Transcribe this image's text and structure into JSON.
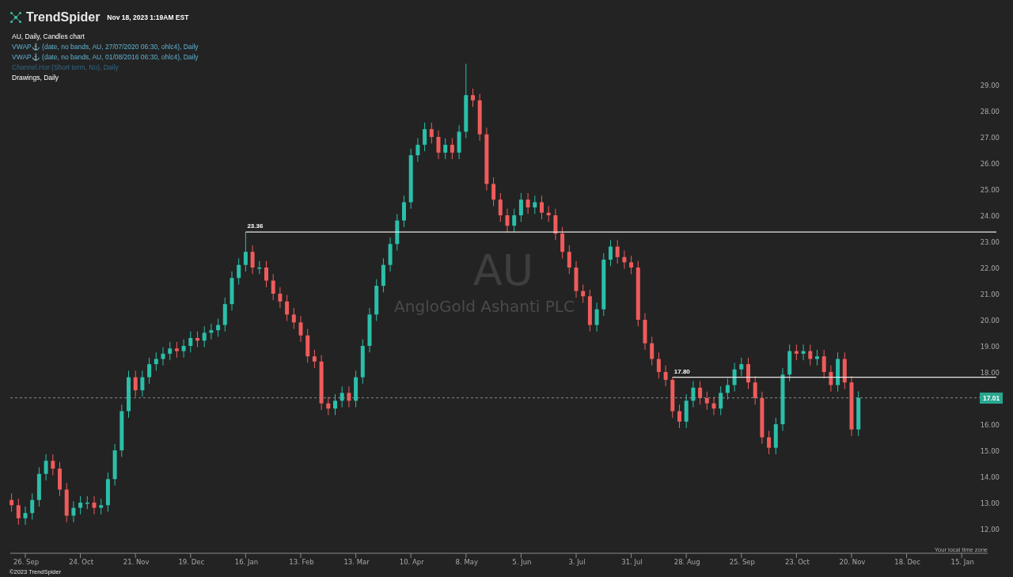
{
  "header": {
    "brand": "TrendSpider",
    "timestamp": "Nov 18, 2023 1:19AM EST"
  },
  "legend": [
    {
      "text": "AU, Daily, Candles chart",
      "kind": "chart",
      "visible": true
    },
    {
      "text": "VWAP⚓ (date, no bands, AU, 27/07/2020 06:30, ohlc4), Daily",
      "kind": "study",
      "visible": true
    },
    {
      "text": "VWAP⚓ (date, no bands, AU, 01/08/2016 06:30, ohlc4), Daily",
      "kind": "study",
      "visible": true
    },
    {
      "text": "Channel.Hor (Short term, No), Daily",
      "kind": "study",
      "visible": false
    },
    {
      "text": "Drawings, Daily",
      "kind": "drawings",
      "visible": true
    }
  ],
  "watermark": {
    "symbol": "AU",
    "name": "AngloGold Ashanti PLC"
  },
  "chart": {
    "chart_data": {
      "type": "candlestick",
      "ylim": [
        12,
        29
      ],
      "categories": [
        null,
        null,
        "26. Sep",
        null,
        null,
        null,
        null,
        null,
        null,
        null,
        "24. Oct",
        null,
        null,
        null,
        null,
        null,
        null,
        null,
        "21. Nov",
        null,
        null,
        null,
        null,
        null,
        null,
        null,
        "19. Dec",
        null,
        null,
        null,
        null,
        null,
        null,
        null,
        "16. Jan",
        null,
        null,
        null,
        null,
        null,
        null,
        null,
        "13. Feb",
        null,
        null,
        null,
        null,
        null,
        null,
        null,
        "13. Mar",
        null,
        null,
        null,
        null,
        null,
        null,
        null,
        "10. Apr",
        null,
        null,
        null,
        null,
        null,
        null,
        null,
        "8. May",
        null,
        null,
        null,
        null,
        null,
        null,
        null,
        "5. Jun",
        null,
        null,
        null,
        null,
        null,
        null,
        null,
        "3. Jul",
        null,
        null,
        null,
        null,
        null,
        null,
        null,
        "31. Jul",
        null,
        null,
        null,
        null,
        null,
        null,
        null,
        "28. Aug",
        null,
        null,
        null,
        null,
        null,
        null,
        null,
        "25. Sep",
        null,
        null,
        null,
        null,
        null,
        null,
        null,
        "23. Oct",
        null,
        null,
        null,
        null,
        null,
        null,
        null,
        "20. Nov",
        null,
        null,
        null,
        null,
        null,
        null,
        null,
        "18. Dec",
        null,
        null,
        null,
        null,
        null,
        null,
        null,
        "15. Jan",
        null,
        null
      ],
      "ohlc": [
        [
          13.1,
          13.35,
          12.65,
          12.9
        ],
        [
          12.9,
          13.15,
          12.15,
          12.4
        ],
        [
          12.4,
          12.85,
          12.15,
          12.6
        ],
        [
          12.6,
          13.35,
          12.35,
          13.1
        ],
        [
          13.1,
          14.35,
          12.85,
          14.1
        ],
        [
          14.1,
          14.85,
          13.85,
          14.6
        ],
        [
          14.6,
          14.85,
          14.05,
          14.3
        ],
        [
          14.3,
          14.55,
          13.25,
          13.5
        ],
        [
          13.5,
          13.75,
          12.25,
          12.5
        ],
        [
          12.5,
          13.05,
          12.25,
          12.8
        ],
        [
          12.8,
          13.25,
          12.55,
          13.0
        ],
        [
          13.0,
          13.25,
          12.75,
          13.0
        ],
        [
          13.0,
          13.25,
          12.55,
          12.8
        ],
        [
          12.8,
          13.15,
          12.55,
          12.9
        ],
        [
          12.9,
          14.15,
          12.65,
          13.9
        ],
        [
          13.9,
          15.25,
          13.65,
          15.0
        ],
        [
          15.0,
          16.75,
          14.75,
          16.5
        ],
        [
          16.5,
          18.05,
          16.25,
          17.8
        ],
        [
          17.8,
          18.05,
          17.05,
          17.3
        ],
        [
          17.3,
          18.05,
          17.05,
          17.8
        ],
        [
          17.8,
          18.55,
          17.55,
          18.3
        ],
        [
          18.3,
          18.75,
          18.05,
          18.5
        ],
        [
          18.5,
          18.95,
          18.25,
          18.7
        ],
        [
          18.7,
          19.15,
          18.45,
          18.9
        ],
        [
          18.9,
          19.15,
          18.55,
          18.8
        ],
        [
          18.8,
          19.25,
          18.55,
          19.0
        ],
        [
          19.0,
          19.55,
          18.75,
          19.3
        ],
        [
          19.3,
          19.55,
          18.95,
          19.2
        ],
        [
          19.2,
          19.75,
          18.95,
          19.5
        ],
        [
          19.5,
          19.85,
          19.25,
          19.6
        ],
        [
          19.6,
          20.05,
          19.35,
          19.8
        ],
        [
          19.8,
          20.85,
          19.55,
          20.6
        ],
        [
          20.6,
          21.85,
          20.35,
          21.6
        ],
        [
          21.6,
          22.35,
          21.35,
          22.1
        ],
        [
          22.1,
          23.36,
          21.85,
          22.6
        ],
        [
          22.6,
          22.85,
          21.75,
          22.0
        ],
        [
          22.0,
          22.25,
          21.75,
          22.0
        ],
        [
          22.0,
          22.25,
          21.25,
          21.5
        ],
        [
          21.5,
          21.75,
          20.75,
          21.0
        ],
        [
          21.0,
          21.25,
          20.45,
          20.7
        ],
        [
          20.7,
          20.95,
          19.95,
          20.2
        ],
        [
          20.2,
          20.45,
          19.65,
          19.9
        ],
        [
          19.9,
          20.15,
          19.15,
          19.4
        ],
        [
          19.4,
          19.65,
          18.35,
          18.6
        ],
        [
          18.6,
          18.85,
          18.15,
          18.4
        ],
        [
          18.4,
          18.65,
          16.55,
          16.8
        ],
        [
          16.8,
          17.05,
          16.35,
          16.6
        ],
        [
          16.6,
          17.15,
          16.35,
          16.9
        ],
        [
          16.9,
          17.45,
          16.65,
          17.2
        ],
        [
          17.2,
          17.45,
          16.65,
          16.9
        ],
        [
          16.9,
          18.05,
          16.65,
          17.8
        ],
        [
          17.8,
          19.25,
          17.55,
          19.0
        ],
        [
          19.0,
          20.45,
          18.75,
          20.2
        ],
        [
          20.2,
          21.55,
          19.95,
          21.3
        ],
        [
          21.3,
          22.35,
          21.05,
          22.1
        ],
        [
          22.1,
          23.15,
          21.85,
          22.9
        ],
        [
          22.9,
          24.05,
          22.65,
          23.8
        ],
        [
          23.8,
          24.75,
          23.55,
          24.5
        ],
        [
          24.5,
          26.55,
          24.25,
          26.3
        ],
        [
          26.3,
          26.95,
          26.05,
          26.7
        ],
        [
          26.7,
          27.55,
          26.45,
          27.3
        ],
        [
          27.3,
          27.55,
          26.75,
          27.0
        ],
        [
          27.0,
          27.25,
          26.15,
          26.4
        ],
        [
          26.4,
          26.95,
          26.15,
          26.7
        ],
        [
          26.7,
          26.95,
          26.15,
          26.4
        ],
        [
          26.4,
          27.45,
          26.15,
          27.2
        ],
        [
          27.2,
          29.8,
          26.95,
          28.6
        ],
        [
          28.6,
          28.85,
          28.15,
          28.4
        ],
        [
          28.4,
          28.65,
          26.85,
          27.1
        ],
        [
          27.1,
          27.35,
          24.95,
          25.2
        ],
        [
          25.2,
          25.45,
          24.35,
          24.6
        ],
        [
          24.6,
          24.85,
          23.75,
          24.0
        ],
        [
          24.0,
          24.25,
          23.35,
          23.6
        ],
        [
          23.6,
          24.25,
          23.35,
          24.0
        ],
        [
          24.0,
          24.85,
          23.75,
          24.6
        ],
        [
          24.6,
          24.85,
          24.05,
          24.3
        ],
        [
          24.3,
          24.75,
          24.05,
          24.5
        ],
        [
          24.5,
          24.75,
          23.85,
          24.1
        ],
        [
          24.1,
          24.35,
          23.75,
          24.0
        ],
        [
          24.0,
          24.25,
          23.05,
          23.3
        ],
        [
          23.3,
          23.55,
          22.35,
          22.6
        ],
        [
          22.6,
          22.85,
          21.75,
          22.0
        ],
        [
          22.0,
          22.25,
          20.85,
          21.1
        ],
        [
          21.1,
          21.35,
          20.65,
          20.9
        ],
        [
          20.9,
          21.15,
          19.55,
          19.8
        ],
        [
          19.8,
          20.65,
          19.55,
          20.4
        ],
        [
          20.4,
          22.55,
          20.15,
          22.3
        ],
        [
          22.3,
          23.05,
          22.05,
          22.8
        ],
        [
          22.8,
          23.05,
          22.15,
          22.4
        ],
        [
          22.4,
          22.65,
          21.95,
          22.2
        ],
        [
          22.2,
          22.45,
          21.75,
          22.0
        ],
        [
          22.0,
          22.25,
          19.75,
          20.0
        ],
        [
          20.0,
          20.25,
          18.85,
          19.1
        ],
        [
          19.1,
          19.35,
          18.25,
          18.5
        ],
        [
          18.5,
          18.75,
          17.75,
          18.0
        ],
        [
          18.0,
          18.25,
          17.45,
          17.7
        ],
        [
          17.7,
          17.8,
          16.25,
          16.5
        ],
        [
          16.5,
          16.75,
          15.85,
          16.1
        ],
        [
          16.1,
          17.15,
          15.85,
          16.9
        ],
        [
          16.9,
          17.65,
          16.65,
          17.4
        ],
        [
          17.4,
          17.65,
          16.75,
          17.0
        ],
        [
          17.0,
          17.25,
          16.55,
          16.8
        ],
        [
          16.8,
          17.05,
          16.35,
          16.6
        ],
        [
          16.6,
          17.45,
          16.35,
          17.2
        ],
        [
          17.2,
          17.75,
          16.95,
          17.5
        ],
        [
          17.5,
          18.35,
          17.25,
          18.1
        ],
        [
          18.1,
          18.55,
          17.85,
          18.3
        ],
        [
          18.3,
          18.55,
          17.35,
          17.6
        ],
        [
          17.6,
          17.85,
          16.75,
          17.0
        ],
        [
          17.0,
          17.25,
          15.25,
          15.5
        ],
        [
          15.5,
          15.75,
          14.85,
          15.1
        ],
        [
          15.1,
          16.25,
          14.85,
          16.0
        ],
        [
          16.0,
          18.15,
          15.75,
          17.9
        ],
        [
          17.9,
          19.05,
          17.65,
          18.8
        ],
        [
          18.8,
          19.05,
          18.45,
          18.7
        ],
        [
          18.7,
          19.05,
          18.45,
          18.8
        ],
        [
          18.8,
          19.05,
          18.25,
          18.5
        ],
        [
          18.5,
          18.85,
          18.25,
          18.6
        ],
        [
          18.6,
          18.85,
          17.75,
          18.0
        ],
        [
          18.0,
          18.25,
          17.25,
          17.5
        ],
        [
          17.5,
          18.75,
          17.25,
          18.5
        ],
        [
          18.5,
          18.75,
          17.35,
          17.6
        ],
        [
          17.6,
          17.85,
          15.55,
          15.8
        ],
        [
          15.8,
          17.26,
          15.55,
          17.01
        ],
        null,
        null,
        null,
        null,
        null,
        null,
        null,
        null,
        null,
        null,
        null,
        null,
        null,
        null,
        null,
        null,
        null
      ],
      "yticks": [
        {
          "value": 12,
          "label": "12.00"
        },
        {
          "value": 13,
          "label": "13.00"
        },
        {
          "value": 14,
          "label": "14.00"
        },
        {
          "value": 15,
          "label": "15.00"
        },
        {
          "value": 16,
          "label": "16.00"
        },
        {
          "value": 18,
          "label": "18.00"
        },
        {
          "value": 19,
          "label": "19.00"
        },
        {
          "value": 20,
          "label": "20.00"
        },
        {
          "value": 21,
          "label": "21.00"
        },
        {
          "value": 22,
          "label": "22.00"
        },
        {
          "value": 23,
          "label": "23.00"
        },
        {
          "value": 24,
          "label": "24.00"
        },
        {
          "value": 25,
          "label": "25.00"
        },
        {
          "value": 26,
          "label": "26.00"
        },
        {
          "value": 27,
          "label": "27.00"
        },
        {
          "value": 28,
          "label": "28.00"
        },
        {
          "value": 29,
          "label": "29.00"
        }
      ],
      "ref_lines": [
        {
          "axis": "y",
          "value": 23.36,
          "label": "23.36"
        },
        {
          "axis": "y",
          "value": 17.8,
          "label": "17.80"
        },
        {
          "axis": "y",
          "value": 17.01,
          "label": "17.01"
        }
      ]
    },
    "timezone_note": "Your local time zone"
  },
  "footer": "©2023 TrendSpider"
}
